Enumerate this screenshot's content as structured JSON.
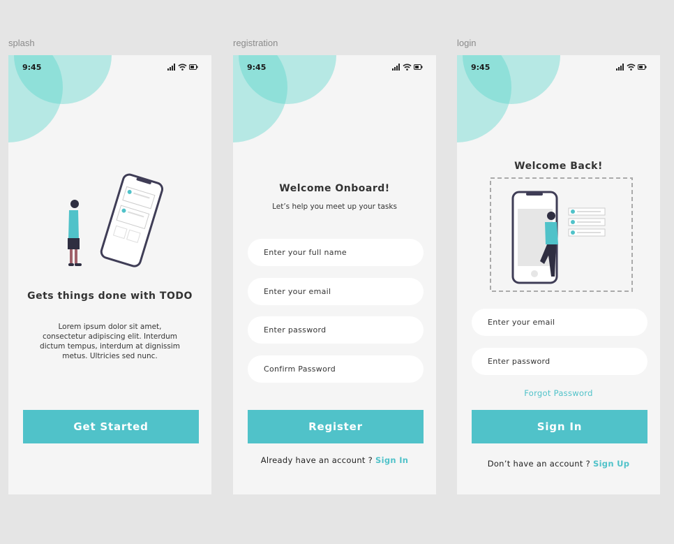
{
  "colors": {
    "accent": "#50c2c9",
    "background": "#f5f5f5",
    "canvas": "#e5e5e5",
    "blob": "#8fe3dc"
  },
  "frames": {
    "splash": {
      "label": "splash",
      "time": "9:45",
      "title": "Gets things done with TODO",
      "body": [
        "Lorem ipsum dolor sit amet,",
        "consectetur adipiscing elit. Interdum",
        "dictum tempus, interdum at dignissim",
        "metus. Ultricies sed nunc."
      ],
      "button": "Get Started",
      "illustration": "person-looking-at-phone-illustration"
    },
    "registration": {
      "label": "registration",
      "time": "9:45",
      "title": "Welcome Onboard!",
      "subtitle": "Let’s help you meet up your tasks",
      "fields": [
        "Enter your full name",
        "Enter your email",
        "Enter password",
        "Confirm Password"
      ],
      "button": "Register",
      "footer_text": "Already have an account ? ",
      "footer_link": "Sign In"
    },
    "login": {
      "label": "login",
      "time": "9:45",
      "title": "Welcome Back!",
      "fields": [
        "Enter your email",
        "Enter password"
      ],
      "forgot": "Forgot Password",
      "button": "Sign In",
      "footer_text": "Don’t have an account ? ",
      "footer_link": "Sign Up",
      "illustration": "person-leaning-on-phone-illustration"
    }
  }
}
